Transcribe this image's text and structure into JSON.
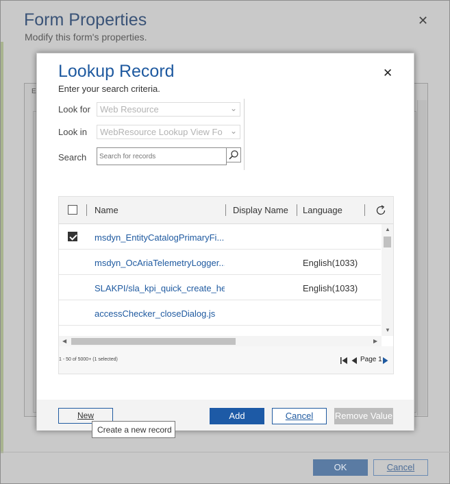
{
  "outer_dialog": {
    "title": "Form Properties",
    "subtitle": "Modify this form's properties.",
    "tab_fragment": "E",
    "ok_label": "OK",
    "cancel_label": "Cancel"
  },
  "lookup_dialog": {
    "title": "Lookup Record",
    "subtitle": "Enter your search criteria.",
    "look_for_label": "Look for",
    "look_for_value": "Web Resource",
    "look_in_label": "Look in",
    "look_in_value": "WebResource Lookup View Fo",
    "search_label": "Search",
    "search_placeholder": "Search for records"
  },
  "grid": {
    "columns": [
      "Name",
      "Display Name",
      "Language"
    ],
    "rows": [
      {
        "name": "msdyn_EntityCatalogPrimaryFi...",
        "language": "",
        "selected": true
      },
      {
        "name": "msdyn_OcAriaTelemetryLogger...",
        "language": "English(1033)",
        "selected": false
      },
      {
        "name": "SLAKPI/sla_kpi_quick_create_he...",
        "language": "English(1033)",
        "selected": false
      },
      {
        "name": "accessChecker_closeDialog.js",
        "language": "",
        "selected": false
      }
    ],
    "status": "1 - 50 of 5000+ (1 selected)",
    "page_label": "Page 1"
  },
  "footer": {
    "new_label": "New",
    "add_label": "Add",
    "cancel_label": "Cancel",
    "remove_label": "Remove Value",
    "tooltip": "Create a new record"
  },
  "colors": {
    "title_blue": "#1f5aa0",
    "primary_button": "#1d5aa6",
    "disabled_button": "#bcbcbc"
  },
  "icons": [
    "close-icon",
    "chevron-down-icon",
    "search-icon",
    "refresh-icon",
    "first-page-icon",
    "previous-page-icon",
    "next-page-icon",
    "checkmark-icon"
  ]
}
